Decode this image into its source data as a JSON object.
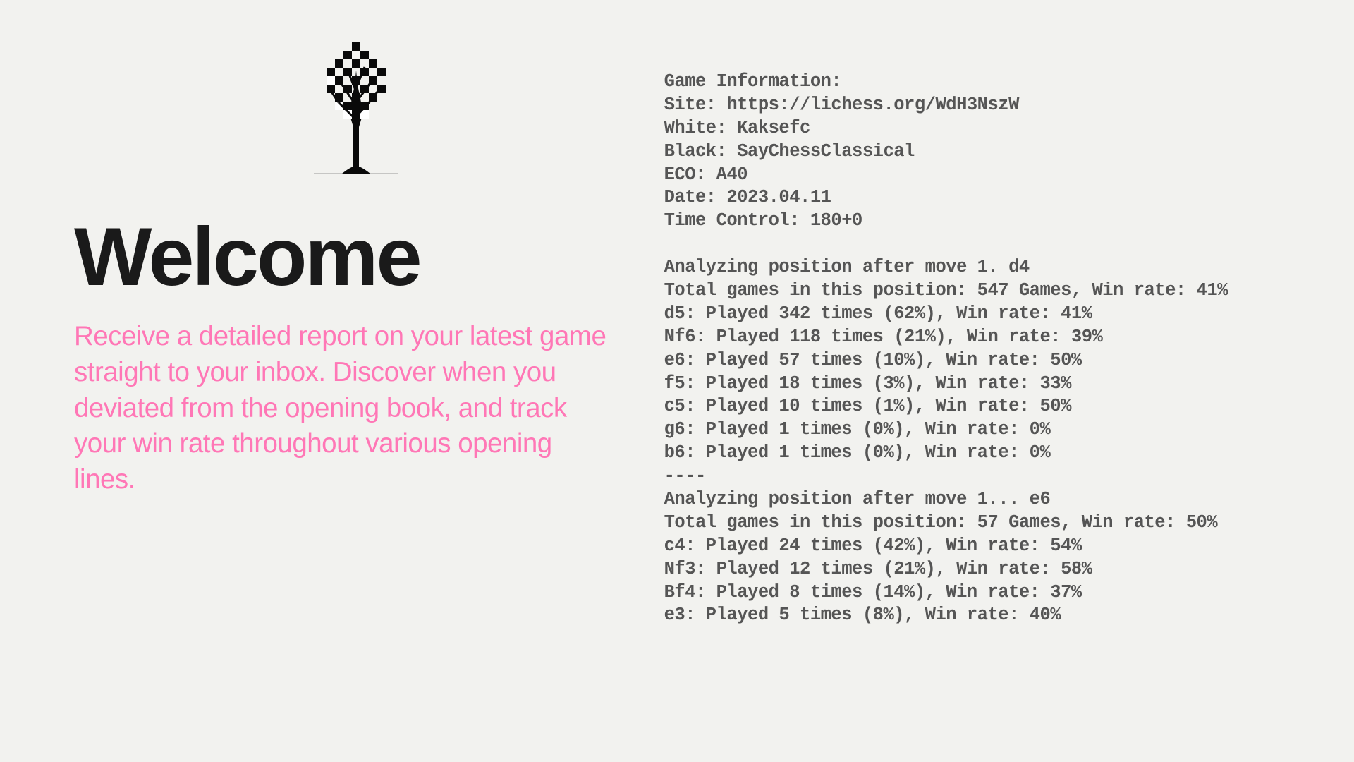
{
  "heading": "Welcome",
  "description": "Receive a detailed report on your latest game straight to your inbox. Discover when you deviated from the opening book, and track your win rate throughout various opening lines.",
  "report": {
    "header_label": "Game Information:",
    "site_label": "Site:",
    "site_value": "https://lichess.org/WdH3NszW",
    "white_label": "White:",
    "white_value": "Kaksefc",
    "black_label": "Black:",
    "black_value": "SayChessClassical",
    "eco_label": "ECO:",
    "eco_value": "A40",
    "date_label": "Date:",
    "date_value": "2023.04.11",
    "tc_label": "Time Control:",
    "tc_value": "180+0",
    "pos1_heading": "Analyzing position after move 1. d4",
    "pos1_total": "Total games in this position: 547 Games, Win rate: 41%",
    "pos1_moves": [
      "d5: Played 342 times (62%), Win rate: 41%",
      "Nf6: Played 118 times (21%), Win rate: 39%",
      "e6: Played 57 times (10%), Win rate: 50%",
      "f5: Played 18 times (3%), Win rate: 33%",
      "c5: Played 10 times (1%), Win rate: 50%",
      "g6: Played 1 times (0%), Win rate: 0%",
      "b6: Played 1 times (0%), Win rate: 0%"
    ],
    "separator": "----",
    "pos2_heading": "Analyzing position after move 1... e6",
    "pos2_total": "Total games in this position: 57 Games, Win rate: 50%",
    "pos2_moves": [
      "c4: Played 24 times (42%), Win rate: 54%",
      "Nf3: Played 12 times (21%), Win rate: 58%",
      "Bf4: Played 8 times (14%), Win rate: 37%",
      "e3: Played 5 times (8%), Win rate: 40%"
    ]
  }
}
